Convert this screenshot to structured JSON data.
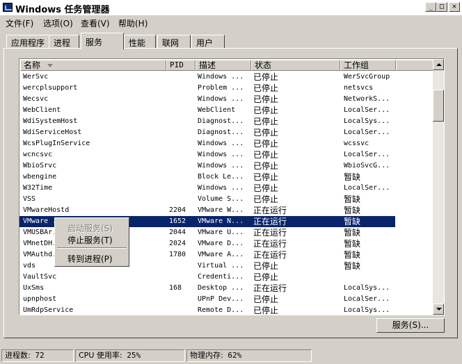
{
  "window": {
    "title": "Windows 任务管理器",
    "minimize": "_",
    "maximize": "□",
    "close": "✕"
  },
  "menu": [
    "文件(F)",
    "选项(O)",
    "查看(V)",
    "帮助(H)"
  ],
  "tabs": [
    "应用程序",
    "进程",
    "服务",
    "性能",
    "联网",
    "用户"
  ],
  "active_tab": "服务",
  "columns": {
    "name": "名称",
    "pid": "PID",
    "desc": "描述",
    "status": "状态",
    "group": "工作组"
  },
  "rows": [
    {
      "name": "WerSvc",
      "pid": "",
      "desc": "Windows ...",
      "status": "已停止",
      "group": "WerSvcGroup"
    },
    {
      "name": "wercplsupport",
      "pid": "",
      "desc": "Problem ...",
      "status": "已停止",
      "group": "netsvcs"
    },
    {
      "name": "Wecsvc",
      "pid": "",
      "desc": "Windows ...",
      "status": "已停止",
      "group": "NetworkS..."
    },
    {
      "name": "WebClient",
      "pid": "",
      "desc": "WebClient",
      "status": "已停止",
      "group": "LocalSer..."
    },
    {
      "name": "WdiSystemHost",
      "pid": "",
      "desc": "Diagnost...",
      "status": "已停止",
      "group": "LocalSys..."
    },
    {
      "name": "WdiServiceHost",
      "pid": "",
      "desc": "Diagnost...",
      "status": "已停止",
      "group": "LocalSer..."
    },
    {
      "name": "WcsPlugInService",
      "pid": "",
      "desc": "Windows ...",
      "status": "已停止",
      "group": "wcssvc"
    },
    {
      "name": "wcncsvc",
      "pid": "",
      "desc": "Windows ...",
      "status": "已停止",
      "group": "LocalSer..."
    },
    {
      "name": "WbioSrvc",
      "pid": "",
      "desc": "Windows ...",
      "status": "已停止",
      "group": "WbioSvcG..."
    },
    {
      "name": "wbengine",
      "pid": "",
      "desc": "Block Le...",
      "status": "已停止",
      "group": "暂缺"
    },
    {
      "name": "W32Time",
      "pid": "",
      "desc": "Windows ...",
      "status": "已停止",
      "group": "LocalSer..."
    },
    {
      "name": "VSS",
      "pid": "",
      "desc": "Volume S...",
      "status": "已停止",
      "group": "暂缺"
    },
    {
      "name": "VMwareHostd",
      "pid": "2204",
      "desc": "VMware W...",
      "status": "正在运行",
      "group": "暂缺"
    },
    {
      "name": "VMware ...",
      "pid": "1652",
      "desc": "VMware N...",
      "status": "正在运行",
      "group": "暂缺",
      "selected": true
    },
    {
      "name": "VMUSBAr...",
      "pid": "2044",
      "desc": "VMware U...",
      "status": "正在运行",
      "group": "暂缺"
    },
    {
      "name": "VMnetDH...",
      "pid": "2024",
      "desc": "VMware D...",
      "status": "正在运行",
      "group": "暂缺"
    },
    {
      "name": "VMAuthd...",
      "pid": "1780",
      "desc": "VMware A...",
      "status": "正在运行",
      "group": "暂缺"
    },
    {
      "name": "vds",
      "pid": "",
      "desc": "Virtual ...",
      "status": "已停止",
      "group": "暂缺"
    },
    {
      "name": "VaultSvc",
      "pid": "",
      "desc": "Credenti...",
      "status": "已停止",
      "group": ""
    },
    {
      "name": "UxSms",
      "pid": "168",
      "desc": "Desktop ...",
      "status": "正在运行",
      "group": "LocalSys..."
    },
    {
      "name": "upnphost",
      "pid": "",
      "desc": "UPnP Dev...",
      "status": "已停止",
      "group": "LocalSer..."
    },
    {
      "name": "UmRdpService",
      "pid": "",
      "desc": "Remote D...",
      "status": "已停止",
      "group": "LocalSys..."
    }
  ],
  "context_menu": {
    "start": "启动服务(S)",
    "stop": "停止服务(T)",
    "goto": "转到进程(P)"
  },
  "services_button": "服务(S)...",
  "status": {
    "processes_label": "进程数:",
    "processes": "72",
    "cpu_label": "CPU 使用率:",
    "cpu": "25%",
    "mem_label": "物理内存:",
    "mem": "62%"
  }
}
